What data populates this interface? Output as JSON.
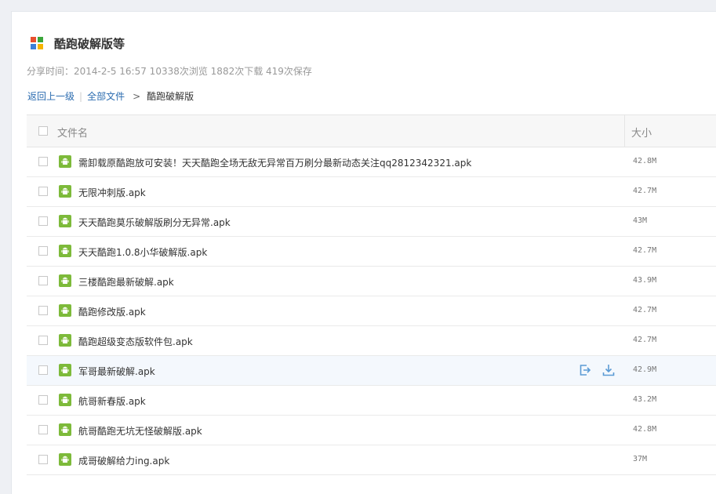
{
  "share": {
    "title": "酷跑破解版等",
    "meta": "分享时间：2014-2-5 16:57 10338次浏览 1882次下载 419次保存"
  },
  "breadcrumb": {
    "back": "返回上一级",
    "all": "全部文件",
    "current": "酷跑破解版"
  },
  "table": {
    "header_name": "文件名",
    "header_size": "大小",
    "rows": [
      {
        "name": "需卸载原酷跑放可安装！天天酷跑全场无敌无异常百万刷分最新动态关注qq2812342321.apk",
        "size": "42.8M"
      },
      {
        "name": "无限冲刺版.apk",
        "size": "42.7M"
      },
      {
        "name": "天天酷跑莫乐破解版刷分无异常.apk",
        "size": "43M"
      },
      {
        "name": "天天酷跑1.0.8小华破解版.apk",
        "size": "42.7M"
      },
      {
        "name": "三楼酷跑最新破解.apk",
        "size": "43.9M"
      },
      {
        "name": "酷跑修改版.apk",
        "size": "42.7M"
      },
      {
        "name": "酷跑超级变态版软件包.apk",
        "size": "42.7M"
      },
      {
        "name": "军哥最新破解.apk",
        "size": "42.9M"
      },
      {
        "name": "航哥新春版.apk",
        "size": "43.2M"
      },
      {
        "name": "航哥酷跑无坑无怪破解版.apk",
        "size": "42.8M"
      },
      {
        "name": "成哥破解给力ing.apk",
        "size": "37M"
      }
    ]
  },
  "row_actions": [
    "save-to-disk-icon",
    "download-icon"
  ],
  "colors": {
    "link": "#2b6cb0",
    "apk_icon": "#7dba3a",
    "hover_row": "#f4f8fd",
    "action_icon": "#5b9bd5",
    "logo": [
      "#e8502f",
      "#3aa63a",
      "#3d7fd8",
      "#f5b400"
    ]
  }
}
